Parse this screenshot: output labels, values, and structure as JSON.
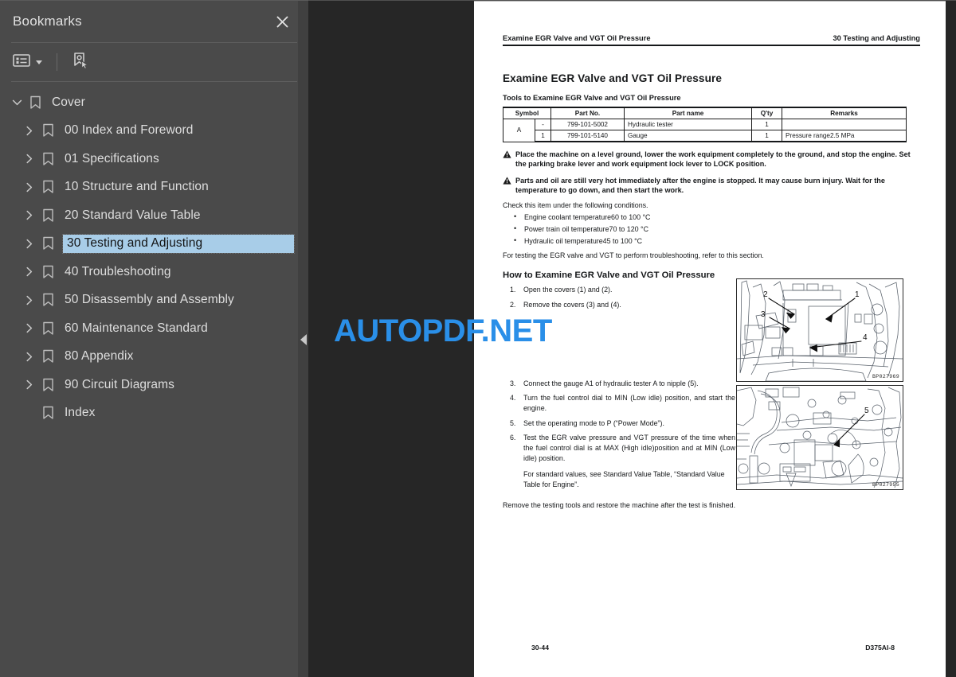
{
  "sidebar": {
    "title": "Bookmarks",
    "close_icon": "close-icon",
    "toolbar": {
      "options_icon": "bookmark-options-list-icon",
      "caret_icon": "chevron-down-icon",
      "new_bookmark_icon": "new-bookmark-pointer-icon"
    },
    "collapse_icon": "collapse-panel-triangle-left-icon",
    "items": [
      {
        "label": "Cover",
        "level": 0,
        "expanded": true,
        "has_children": true,
        "selected": false
      },
      {
        "label": "00 Index and Foreword",
        "level": 1,
        "expanded": false,
        "has_children": true,
        "selected": false
      },
      {
        "label": "01 Specifications",
        "level": 1,
        "expanded": false,
        "has_children": true,
        "selected": false
      },
      {
        "label": "10 Structure and Function",
        "level": 1,
        "expanded": false,
        "has_children": true,
        "selected": false
      },
      {
        "label": "20 Standard Value Table",
        "level": 1,
        "expanded": false,
        "has_children": true,
        "selected": false
      },
      {
        "label": "30 Testing and Adjusting",
        "level": 1,
        "expanded": false,
        "has_children": true,
        "selected": true
      },
      {
        "label": "40 Troubleshooting",
        "level": 1,
        "expanded": false,
        "has_children": true,
        "selected": false
      },
      {
        "label": "50 Disassembly and Assembly",
        "level": 1,
        "expanded": false,
        "has_children": true,
        "selected": false
      },
      {
        "label": "60 Maintenance Standard",
        "level": 1,
        "expanded": false,
        "has_children": true,
        "selected": false
      },
      {
        "label": "80 Appendix",
        "level": 1,
        "expanded": false,
        "has_children": true,
        "selected": false
      },
      {
        "label": "90 Circuit Diagrams",
        "level": 1,
        "expanded": false,
        "has_children": true,
        "selected": false
      },
      {
        "label": "Index",
        "level": 1,
        "expanded": false,
        "has_children": false,
        "selected": false
      }
    ]
  },
  "watermark": {
    "text_blue": "AUTOPDF",
    "text_suffix": ".NET",
    "full": "AUTOPDF.NET",
    "color": "#2a8fe8"
  },
  "page": {
    "running_head_left": "Examine EGR Valve and VGT Oil Pressure",
    "running_head_right": "30 Testing and Adjusting",
    "title": "Examine EGR Valve and VGT Oil Pressure",
    "tools_heading": "Tools to Examine EGR Valve and VGT Oil Pressure",
    "tools_table": {
      "headers": [
        "Symbol",
        "Part No.",
        "Part name",
        "Q'ty",
        "Remarks"
      ],
      "symbol_group": "A",
      "rows": [
        {
          "index": "-",
          "part_no": "799-101-5002",
          "part_name": "Hydraulic tester",
          "qty": "1",
          "remarks": ""
        },
        {
          "index": "1",
          "part_no": "799-101-5140",
          "part_name": "Gauge",
          "qty": "1",
          "remarks": "Pressure range2.5 MPa"
        }
      ]
    },
    "warnings": [
      "Place the machine on a level ground, lower the work equipment completely to the ground, and stop the engine. Set the parking brake lever and work equipment lock lever to LOCK position.",
      "Parts and oil are still very hot immediately after the engine is stopped. It may cause burn injury. Wait for the temperature to go down, and then start the work."
    ],
    "conditions_intro": "Check this item under the following conditions.",
    "conditions": [
      "Engine coolant temperature60 to 100 °C",
      "Power train oil temperature70 to 120 °C",
      "Hydraulic oil temperature45 to 100 °C"
    ],
    "conditions_note": "For testing the EGR valve and VGT to perform troubleshooting, refer to this section.",
    "how_to_heading": "How to Examine EGR Valve and VGT Oil Pressure",
    "steps": [
      {
        "num": "1.",
        "text": "Open the covers (1) and (2)."
      },
      {
        "num": "2.",
        "text": "Remove the covers (3) and (4)."
      },
      {
        "num": "3.",
        "text": "Connect the gauge A1 of hydraulic tester A to nipple (5)."
      },
      {
        "num": "4.",
        "text": "Turn the fuel control dial to MIN (Low idle) position, and start the engine."
      },
      {
        "num": "5.",
        "text": "Set the operating mode to P (“Power Mode”)."
      },
      {
        "num": "6.",
        "text": "Test the EGR valve pressure and VGT pressure of the time when the fuel control dial is at MAX (High idle)position and at MIN (Low idle) position."
      }
    ],
    "step6_sub": "For standard values, see Standard Value Table, “Standard Value Table for Engine”.",
    "closing_line": "Remove the testing tools and restore the machine after the test is finished.",
    "figures": [
      {
        "name": "egr-covers-location-figure",
        "code": "BP027969",
        "callouts": [
          "1",
          "2",
          "3",
          "4"
        ]
      },
      {
        "name": "vgt-nipple-location-figure",
        "code": "BP027955",
        "callouts": [
          "5"
        ]
      }
    ],
    "footer_left": "30-44",
    "footer_right": "D375AI-8"
  }
}
